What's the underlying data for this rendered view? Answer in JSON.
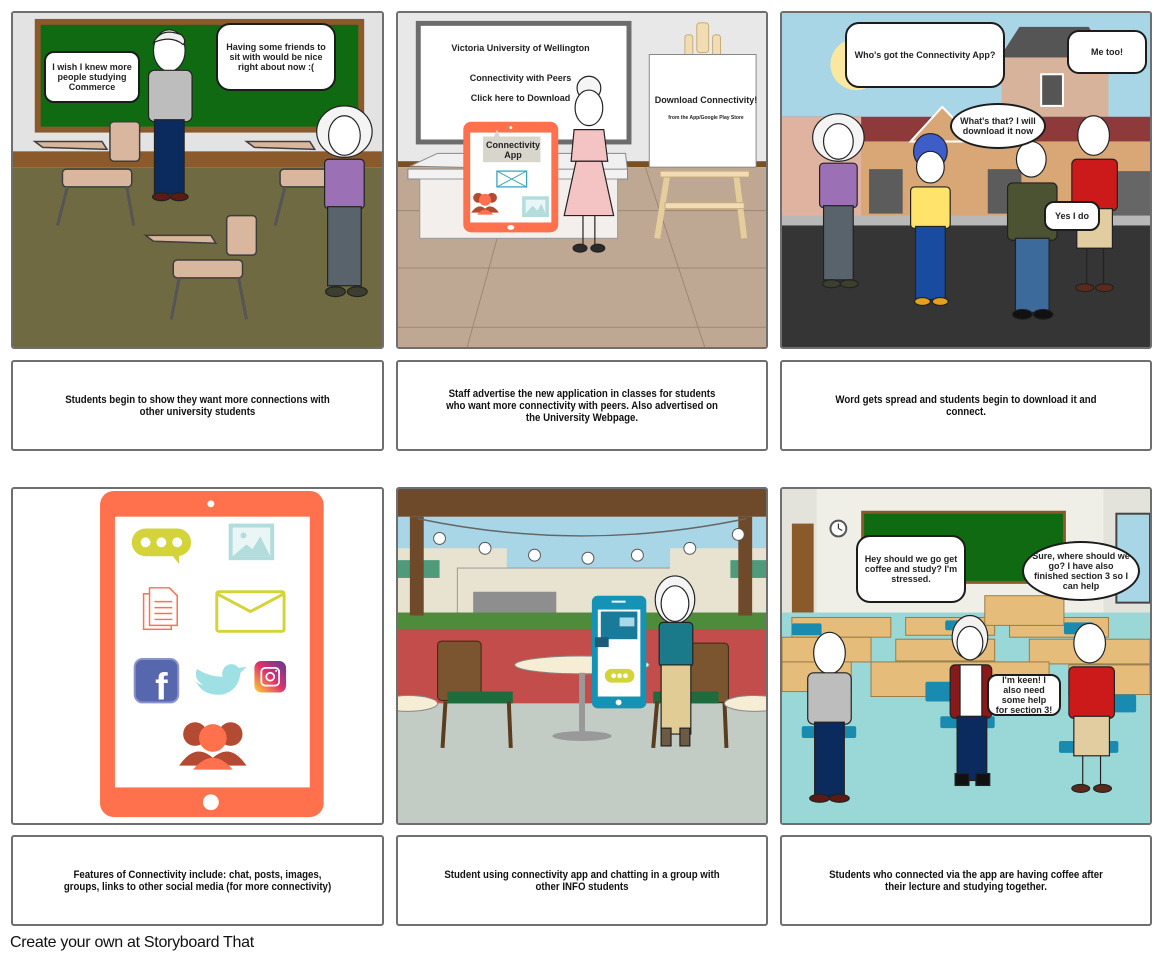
{
  "storyboard": {
    "panels": [
      {
        "id": 1,
        "scene": "classroom-empty-desks",
        "bubbles": [
          {
            "speaker": "boy-grey-shirt",
            "text": "I wish I knew more people studying Commerce"
          },
          {
            "speaker": "girl-purple-top",
            "text": "Having some friends to sit with would be nice right about now :("
          }
        ],
        "caption": "Students begin to show they want more connections with other university students"
      },
      {
        "id": 2,
        "scene": "lecture-hall-presentation",
        "whiteboard": {
          "title": "Victoria University of Wellington",
          "line1": "Connectivity with Peers",
          "line2": "Click here to Download"
        },
        "tablet_label": "Connectivity App",
        "easel": {
          "title": "Download Connectivity!",
          "subtitle": "from the App/Google Play Store"
        },
        "caption": "Staff advertise the new application in classes for students who want more connectivity with peers. Also advertised on the University Webpage."
      },
      {
        "id": 3,
        "scene": "street-outside-buildings",
        "bubbles": [
          {
            "speaker": "girl-purple-top",
            "text": "Who's got the Connectivity App?"
          },
          {
            "speaker": "girl-blue-turban",
            "text": "What's that? I will download it now"
          },
          {
            "speaker": "boy-olive-jacket",
            "text": "Yes I do"
          },
          {
            "speaker": "boy-red-hoodie",
            "text": "Me too!"
          }
        ],
        "caption": "Word gets spread and students begin to download it and connect."
      },
      {
        "id": 4,
        "scene": "tablet-app-features",
        "features": [
          "chat",
          "images",
          "posts",
          "email",
          "facebook",
          "twitter",
          "instagram",
          "groups"
        ],
        "caption": "Features of Connectivity include: chat, posts, images, groups, links to other social media (for more connectivity)"
      },
      {
        "id": 5,
        "scene": "outdoor-cafe-patio",
        "caption": "Student using connectivity app and chatting in a group with other INFO students"
      },
      {
        "id": 6,
        "scene": "classroom-with-students",
        "bubbles": [
          {
            "speaker": "boy-grey-shirt",
            "text": "Hey should we go get coffee and study? I'm stressed."
          },
          {
            "speaker": "girl-red-cardigan",
            "text": "I'm keen! I also need some help for section 3!"
          },
          {
            "speaker": "boy-red-hoodie",
            "text": "Sure, where should we go? I have also finished section 3 so I can help"
          }
        ],
        "caption": "Students who connected via the app are having coffee after their lecture and studying together."
      }
    ]
  },
  "footer": {
    "text": "Create your own at Storyboard That"
  },
  "colors": {
    "panel_border": "#6f6f6f",
    "tablet_orange": "#ff704d",
    "chalkboard_green": "#0f6a12",
    "phone_teal": "#1593b6",
    "chat_yellow": "#d4d43a"
  }
}
